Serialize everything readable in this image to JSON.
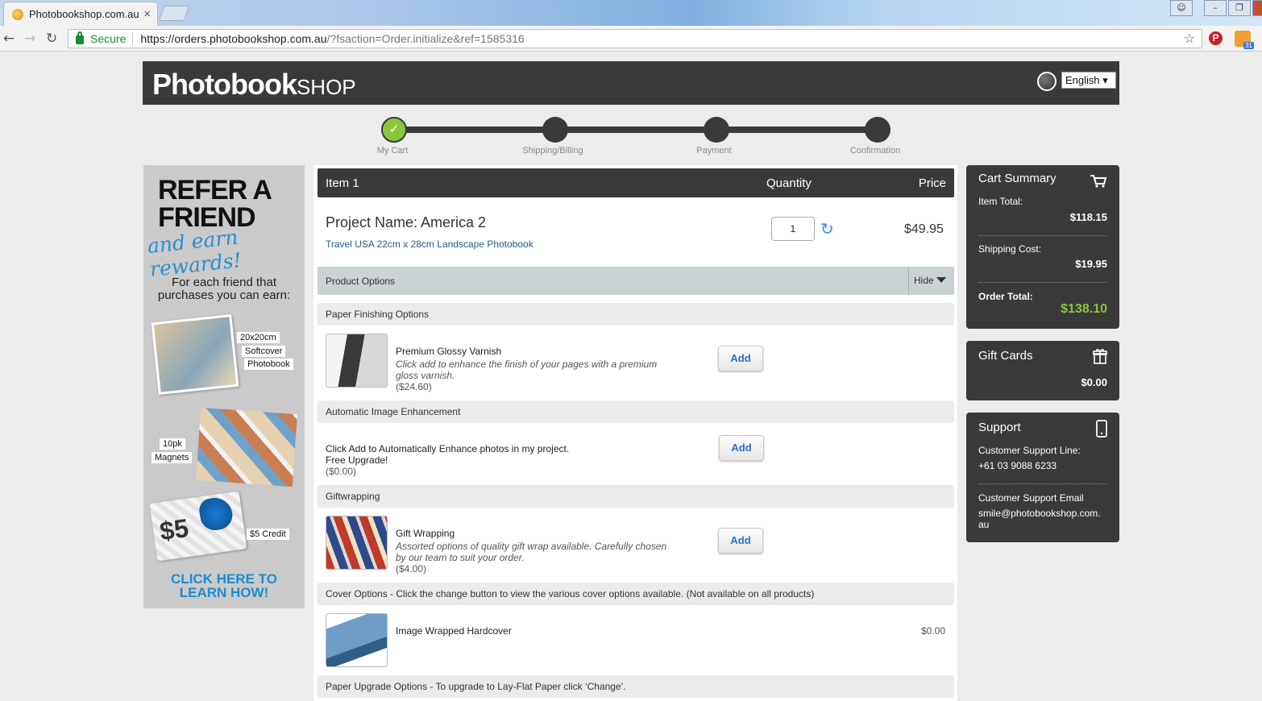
{
  "browser": {
    "tab_title": "Photobookshop.com.au",
    "secure_label": "Secure",
    "url_host": "https://orders.photobookshop.com.au",
    "url_rest": "/?fsaction=Order.initialize&ref=1585316"
  },
  "header": {
    "logo_bold": "Photobook",
    "logo_light": "SHOP",
    "language": "English ▾"
  },
  "steps": [
    {
      "label": "My Cart",
      "done": true
    },
    {
      "label": "Shipping/Billing",
      "done": false
    },
    {
      "label": "Payment",
      "done": false
    },
    {
      "label": "Confirmation",
      "done": false
    }
  ],
  "ad": {
    "headline_1": "REFER A",
    "headline_2": "FRIEND",
    "script": "and earn rewards!",
    "sub_1": "For each friend that",
    "sub_2": "purchases you can earn:",
    "tag_size": "20x20cm",
    "tag_cover": "Softcover",
    "tag_book": "Photobook",
    "tag_10pk": "10pk",
    "tag_magnets": "Magnets",
    "card_value": "$5",
    "tag_credit": "$5 Credit",
    "cta_1": "CLICK HERE TO",
    "cta_2": "LEARN HOW!"
  },
  "cart": {
    "col_item": "Item 1",
    "col_quantity": "Quantity",
    "col_price": "Price",
    "project_name": "Project Name: America 2",
    "project_desc": "Travel USA 22cm x 28cm Landscape Photobook",
    "quantity": "1",
    "price": "$49.95",
    "options_title": "Product Options",
    "hide_label": "Hide"
  },
  "sections": {
    "paper_finishing": "Paper Finishing Options",
    "auto_enhance": "Automatic Image Enhancement",
    "giftwrapping": "Giftwrapping",
    "cover_options": "Cover Options - Click the change button to view the various cover options available. (Not available on all products)",
    "paper_upgrade": "Paper Upgrade Options - To upgrade to Lay-Flat Paper click ‘Change’."
  },
  "options": {
    "varnish": {
      "name": "Premium Glossy Varnish",
      "desc": "Click add to enhance the finish of your pages with a premium gloss varnish.",
      "price": "($24.60)",
      "button": "Add"
    },
    "enhance": {
      "name": "Click Add to Automatically Enhance photos in my project.",
      "note": "Free Upgrade!",
      "price": "($0.00)",
      "button": "Add"
    },
    "giftwrap": {
      "name": "Gift Wrapping",
      "desc": "Assorted options of quality gift wrap available. Carefully chosen by our team to suit your order.",
      "price": "($4.00)",
      "button": "Add"
    },
    "cover": {
      "name": "Image Wrapped Hardcover",
      "price": "$0.00"
    }
  },
  "summary": {
    "title": "Cart Summary",
    "item_total_label": "Item Total:",
    "item_total": "$118.15",
    "shipping_label": "Shipping Cost:",
    "shipping": "$19.95",
    "order_total_label": "Order Total:",
    "order_total": "$138.10"
  },
  "gift_cards": {
    "title": "Gift Cards",
    "value": "$0.00"
  },
  "support": {
    "title": "Support",
    "line_label": "Customer Support Line:",
    "line": "+61 03 9088 6233",
    "email_label": "Customer Support Email",
    "email_1": "smile@photobookshop.com.",
    "email_2": "au"
  },
  "colors": {
    "dark": "#3a3a3a",
    "accent_green": "#8bc63e",
    "link_blue": "#2b6fc4"
  }
}
